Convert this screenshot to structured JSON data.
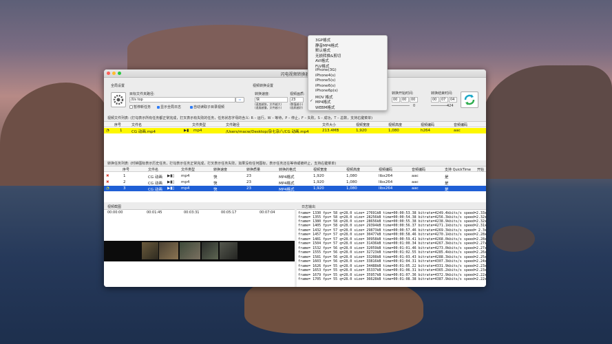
{
  "window": {
    "title": "闪电视频转换器"
  },
  "global_settings": {
    "label": "全局设置",
    "target_folder_label": "目标文件夹路径:",
    "target_folder_value": "/Us                              top",
    "pause_new_tasks": "暂停新任务",
    "show_global_log": "显示全局日志",
    "auto_read_dir": "自动读取子目录视频"
  },
  "video_settings": {
    "label": "视频转换设置",
    "speed_label": "转换速度:",
    "speed_value": "快",
    "speed_hint": "(速度越快，文件越大)\n(速度越慢，文件越小)",
    "quality_label": "视频画质:",
    "quality_value": "23",
    "quality_hint": "(数值越小)\n(画质越好)",
    "start_time_label": "转换开始时间:",
    "start_time_value": [
      "00",
      "00",
      "00"
    ],
    "start_time_extra": "0",
    "end_time_label": "转换结束时间:",
    "end_time_value": [
      "00",
      "07",
      "04"
    ],
    "end_time_extra": "424"
  },
  "format_menu": {
    "items": [
      "3GP格式",
      "静音MP4格式",
      "默认格式",
      "无损转换&剪切",
      "AVI格式",
      "FLV格式",
      "iPhone(3G)",
      "iPhone4(s)",
      "iPhone5(s)",
      "iPhone6(s)",
      "iPhone6p(s)",
      "MOV 格式",
      "MP4格式",
      "WEBM格式"
    ],
    "selected_index": 12,
    "check": "✓"
  },
  "file_list": {
    "caption": "视频文件列表: (打勾表示所有任务都正常完成，打叉表示有失败的任务，任务状态字母的含义: R – 运行，W – 等待，P – 停止，F – 失败，S – 成功，T – 总数，支持右键菜单)",
    "columns": [
      "序号",
      "文件名",
      "文件类型",
      "文件路径",
      "文件大小",
      "视频宽度",
      "视频高度",
      "视频编码",
      "音频编码"
    ],
    "rows": [
      {
        "index": "1",
        "name": "CG 动画.mp4",
        "type": "mp4",
        "path": "/Users/macw/Desktop/杂七杂八/CG 动画.mp4",
        "size": "213.4MB",
        "width": "1,920",
        "height": "1,080",
        "vcodec": "h264",
        "acodec": "aac"
      }
    ]
  },
  "task_list": {
    "caption": "转换任务列表: (时钟图标表示历史任务，打勾表示任务正常完成，打叉表示任务失败，如果没有任何图标，表示任务还在等待或被终止，支持右键菜单)",
    "columns": [
      "序号",
      "文件名",
      "文件类型",
      "转换速度",
      "转换质量",
      "转换的格式",
      "视频宽度",
      "视频高度",
      "视频编码",
      "音频编码",
      "支持 QuickTime",
      "开始"
    ],
    "rows": [
      {
        "status": "fail",
        "index": "1",
        "name": "CG 动画",
        "type": "mp4",
        "speed": "快",
        "quality": "23",
        "format": "MP4格式",
        "width": "1,920",
        "height": "1,080",
        "vcodec": "libx264",
        "acodec": "aac",
        "qt": "是"
      },
      {
        "status": "fail",
        "index": "2",
        "name": "CG 动画",
        "type": "mp4",
        "speed": "快",
        "quality": "23",
        "format": "MP4格式",
        "width": "1,920",
        "height": "1,080",
        "vcodec": "libx264",
        "acodec": "aac",
        "qt": "是"
      },
      {
        "status": "running",
        "index": "3",
        "name": "CG 动画",
        "type": "mp4",
        "speed": "快",
        "quality": "23",
        "format": "MP4格式",
        "width": "1,920",
        "height": "1,080",
        "vcodec": "libx264",
        "acodec": "aac",
        "qt": "是"
      }
    ]
  },
  "preview": {
    "label": "视频截图",
    "timestamps": [
      "00:00:00",
      "00:01:45",
      "00:03:31",
      "00:05:17",
      "00:07:04"
    ]
  },
  "log": {
    "label": "日志输出",
    "lines": [
      "frame= 1330 fps= 58 q=28.0 size=   27691kB time=00:00:53.38 bitrate=4249.4kbits/s speed=2.33x",
      "frame= 1355 fps= 58 q=28.0 size=   28256kB time=00:00:54.38 bitrate=4256.3kbits/s speed=2.32x",
      "frame= 1380 fps= 58 q=28.0 size=   28656kB time=00:00:55.38 bitrate=4238.9kbits/s speed=2.32x",
      "frame= 1405 fps= 58 q=28.0 size=   29394kB time=00:00:56.37 bitrate=4271.1kbits/s speed=2.31x",
      "frame= 1432 fps= 57 q=28.0 size=   29873kB time=00:00:57.46 bitrate=4269.3kbits/s speed= 2.3x",
      "frame= 1457 fps= 57 q=28.0 size=   30477kB time=00:00:58.46 bitrate=4270.1kbits/s speed=2.28x",
      "frame= 1481 fps= 57 q=28.0 size=   30958kB time=00:00:59.41 bitrate=4268.0kbits/s speed=2.28x",
      "frame= 1504 fps= 57 q=28.0 size=   31436kB time=00:01:00.34 bitrate=4267.3kbits/s speed=2.27x",
      "frame= 1532 fps= 56 q=28.0 size=   32059kB time=00:01:01.46 bitrate=4273.0kbits/s speed=2.27x",
      "frame= 1555 fps= 56 q=28.0 size=   32723kB time=00:01:02.55 bitrate=4285.4kbits/s speed=2.26x",
      "frame= 1581 fps= 56 q=28.0 size=   33208kB time=00:01:03.43 bitrate=4288.3kbits/s speed=2.25x",
      "frame= 1603 fps= 56 q=28.0 size=   33816kB time=00:01:04.31 bitrate=4307.3kbits/s speed=2.24x",
      "frame= 1626 fps= 55 q=28.0 size=   34488kB time=00:01:05.22 bitrate=4331.9kbits/s speed=2.23x",
      "frame= 1653 fps= 55 q=28.0 size=   35337kB time=00:01:06.31 bitrate=4365.2kbits/s speed=2.23x",
      "frame= 1679 fps= 55 q=28.0 size=   35957kB time=00:01:07.36 bitrate=4372.9kbits/s speed=2.22x",
      "frame= 1705 fps= 55 q=28.0 size=   36628kB time=00:01:08.38 bitrate=4387.9kbits/s speed=2.22x"
    ]
  },
  "colors": {
    "selection_yellow": "#fdf700",
    "selection_blue": "#1f5fd6",
    "fail_red": "#d23a2a",
    "accent": "#2f7cf6"
  }
}
